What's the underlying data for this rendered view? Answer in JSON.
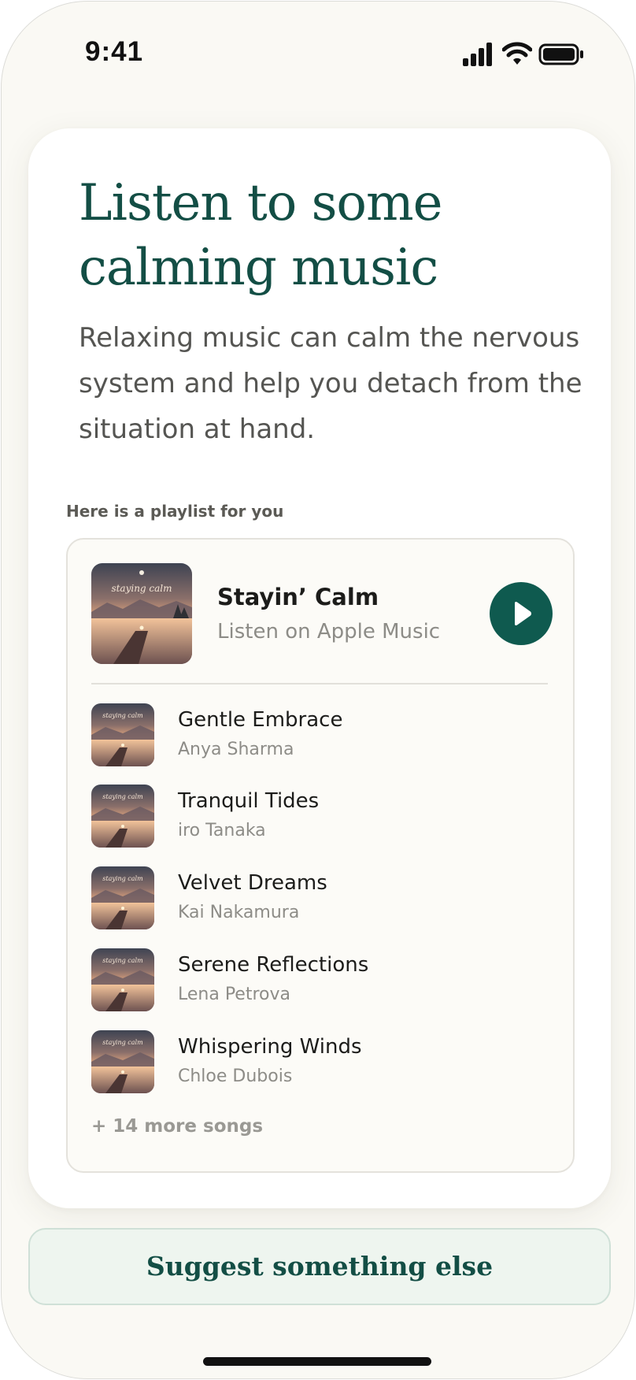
{
  "status_bar": {
    "time": "9:41",
    "icons": [
      "cellular-signal-icon",
      "wifi-icon",
      "battery-icon"
    ]
  },
  "card": {
    "title": "Listen to some calming music",
    "subtitle": "Relaxing music can calm the nervous system and help you detach from the situation at hand.",
    "playlist_heading": "Here is a playlist for you"
  },
  "playlist": {
    "name": "Stayin’ Calm",
    "source": "Listen on Apple Music",
    "cover_text": "staying calm",
    "play_icon": "play-icon",
    "songs": [
      {
        "title": "Gentle Embrace",
        "artist": "Anya Sharma"
      },
      {
        "title": "Tranquil Tides",
        "artist": "iro Tanaka"
      },
      {
        "title": "Velvet Dreams",
        "artist": "Kai Nakamura"
      },
      {
        "title": "Serene Reflections",
        "artist": "Lena Petrova"
      },
      {
        "title": "Whispering Winds",
        "artist": "Chloe Dubois"
      }
    ],
    "more_songs": "+ 14 more songs"
  },
  "actions": {
    "suggest_label": "Suggest something else"
  },
  "colors": {
    "accent": "#0f5a4f",
    "title_green": "#134e45",
    "background": "#faf9f4",
    "suggest_bg": "#eef5ef"
  }
}
